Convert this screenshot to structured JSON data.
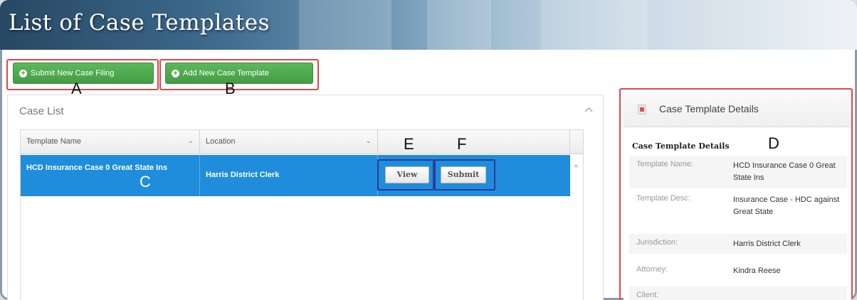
{
  "banner": {
    "title": "List of Case Templates"
  },
  "toolbar": {
    "submit_new_case_filing": "Submit New Case Filing",
    "add_new_case_template": "Add New Case Template"
  },
  "case_list": {
    "title": "Case List",
    "columns": [
      "Template Name",
      "Location"
    ],
    "rows": [
      {
        "template_name": "HCD Insurance Case 0 Great State Ins",
        "location": "Harris District Clerk",
        "actions": {
          "view": "View",
          "submit": "Submit"
        }
      }
    ]
  },
  "details": {
    "header_title": "Case Template Details",
    "section_title": "Case Template Details",
    "fields": [
      {
        "label": "Template Name:",
        "value": "HCD Insurance Case 0 Great State Ins"
      },
      {
        "label": "Template Desc:",
        "value": "Insurance Case - HDC against Great State"
      },
      {
        "label": "Jurisdiction:",
        "value": "Harris District Clerk"
      },
      {
        "label": "Attorney:",
        "value": "Kindra Reese"
      },
      {
        "label": "Client:",
        "value": ""
      }
    ]
  },
  "callouts": {
    "A": "A",
    "B": "B",
    "C": "C",
    "D": "D",
    "E": "E",
    "F": "F"
  },
  "colors": {
    "accent_green": "#5cb85c",
    "selection_blue": "#1f8ddb",
    "callout_red": "#e0454f",
    "callout_navy": "#2b3c96"
  },
  "icons": {
    "plus": "plus-circle-icon",
    "document": "document-icon",
    "collapse": "chevron-up-icon",
    "sort": "chevron-down-icon"
  }
}
